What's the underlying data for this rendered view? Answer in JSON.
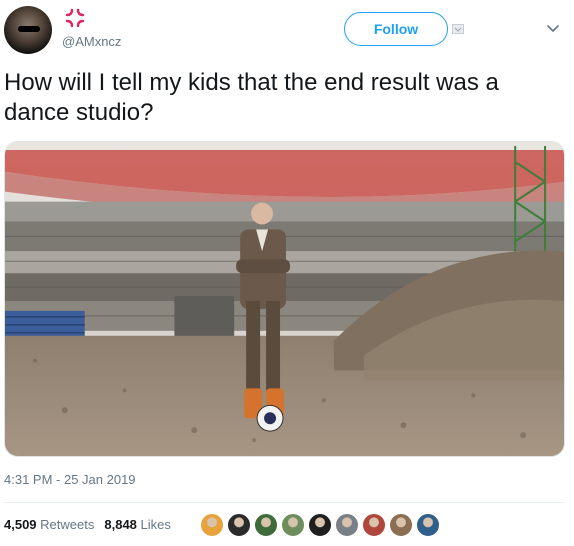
{
  "author": {
    "handle": "@AMxncz",
    "avatar_icon": "profile-photo-icon",
    "badge_icon": "anger-symbol-icon",
    "badge_color": "#e0245e"
  },
  "header": {
    "follow_label": "Follow",
    "menu_icon": "chevron-down-icon"
  },
  "tweet": {
    "text": "How will I tell my kids that the end result was a dance studio?",
    "timestamp": "4:31 PM - 25 Jan 2019"
  },
  "stats": {
    "retweets_count": "4,509",
    "retweets_label": "Retweets",
    "likes_count": "8,848",
    "likes_label": "Likes"
  },
  "likers": [
    {
      "color": "#e7a23b"
    },
    {
      "color": "#2b2b2b"
    },
    {
      "color": "#3f6b3a"
    },
    {
      "color": "#6d8f5e"
    },
    {
      "color": "#1f1f1f"
    },
    {
      "color": "#7a8087"
    },
    {
      "color": "#b0473c"
    },
    {
      "color": "#8c6e52"
    },
    {
      "color": "#2f5f8a"
    }
  ],
  "colors": {
    "accent": "#1da1f2",
    "secondary_text": "#657786",
    "primary_text": "#14171a"
  }
}
